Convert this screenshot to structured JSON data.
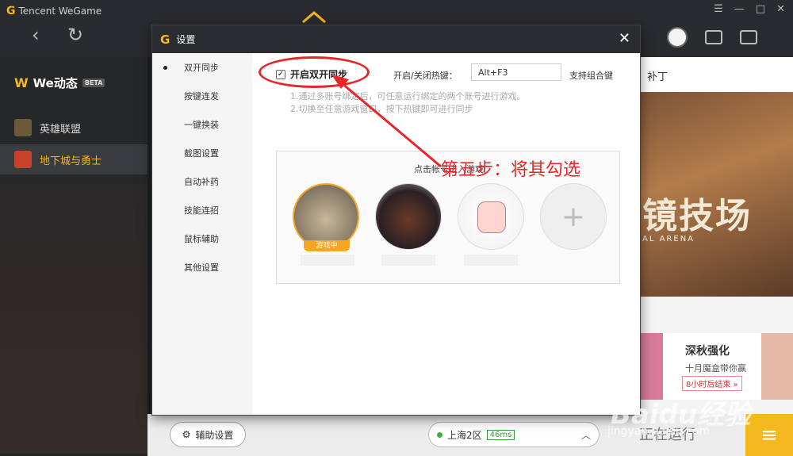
{
  "app": {
    "brand": "Tencent WeGame",
    "window_controls": [
      "☰",
      "—",
      "□",
      "✕"
    ]
  },
  "sidebar": {
    "section_title": "We动态",
    "beta": "BETA",
    "items": [
      {
        "label": "英雄联盟"
      },
      {
        "label": "地下城与勇士"
      }
    ]
  },
  "right_pane": {
    "header": "补丁",
    "banner_big": "镜技场",
    "banner_small": "AL ARENA",
    "card_title": "深秋强化",
    "card_sub": "十月魔盒带你赢",
    "card_tag": "8小时后结束 »"
  },
  "dialog": {
    "title": "设置",
    "close": "✕",
    "nav": [
      "双开同步",
      "按键连发",
      "一键换装",
      "截图设置",
      "自动补药",
      "技能连招",
      "鼠标辅助",
      "其他设置"
    ],
    "sync": {
      "checkbox_label": "开启双开同步",
      "checked": true,
      "hotkey_label": "开启/关闭热键：",
      "hotkey_value": "Alt+F3",
      "combo_note": "支持组合键",
      "hint1": "1.通过多账号绑定后，可任意运行绑定的两个账号进行游戏。",
      "hint2": "2.切换至任意游戏窗口，按下热键即可进行同步"
    },
    "accounts": {
      "title": "点击帐号进入游戏",
      "playing_badge": "游戏中",
      "add": "+"
    }
  },
  "bottombar": {
    "assist_button": "辅助设置",
    "server": "上海2区",
    "ping": "46ms",
    "running": "正在运行"
  },
  "annotation": {
    "text": "第五步：将其勾选",
    "color": "#e8262a"
  },
  "watermark": {
    "main": "Baidu经验",
    "sub": "jingyan.baidu.com"
  }
}
